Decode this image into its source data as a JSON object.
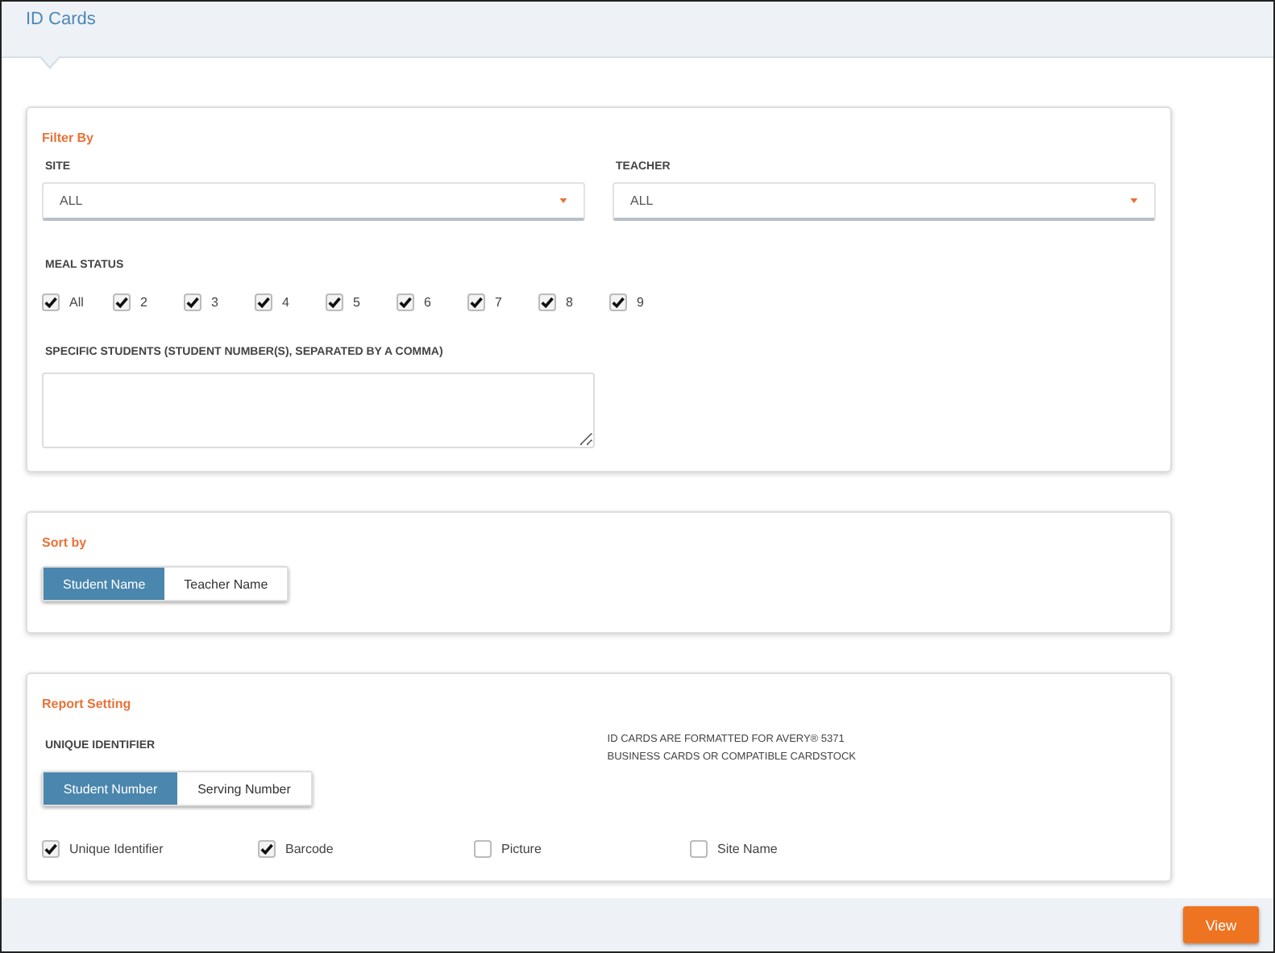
{
  "page": {
    "title": "ID Cards"
  },
  "filter": {
    "title": "Filter By",
    "site": {
      "label": "SITE",
      "value": "ALL"
    },
    "teacher": {
      "label": "TEACHER",
      "value": "ALL"
    },
    "meal_status": {
      "label": "MEAL STATUS",
      "options": [
        {
          "label": "All",
          "checked": true
        },
        {
          "label": "2",
          "checked": true
        },
        {
          "label": "3",
          "checked": true
        },
        {
          "label": "4",
          "checked": true
        },
        {
          "label": "5",
          "checked": true
        },
        {
          "label": "6",
          "checked": true
        },
        {
          "label": "7",
          "checked": true
        },
        {
          "label": "8",
          "checked": true
        },
        {
          "label": "9",
          "checked": true
        }
      ]
    },
    "specific_students": {
      "label": "SPECIFIC STUDENTS (STUDENT NUMBER(S), SEPARATED BY A COMMA)"
    }
  },
  "sort": {
    "title": "Sort by",
    "options": [
      {
        "label": "Student Name",
        "selected": true
      },
      {
        "label": "Teacher Name",
        "selected": false
      }
    ]
  },
  "report": {
    "title": "Report Setting",
    "identifier_label": "UNIQUE IDENTIFIER",
    "identifier_options": [
      {
        "label": "Student Number",
        "selected": true
      },
      {
        "label": "Serving Number",
        "selected": false
      }
    ],
    "note_lines": [
      "ID CARDS ARE FORMATTED FOR AVERY® 5371",
      "BUSINESS CARDS OR COMPATIBLE CARDSTOCK"
    ],
    "fields": [
      {
        "label": "Unique Identifier",
        "checked": true
      },
      {
        "label": "Barcode",
        "checked": true
      },
      {
        "label": "Picture",
        "checked": false
      },
      {
        "label": "Site Name",
        "checked": false
      }
    ]
  },
  "footer": {
    "button": "View"
  }
}
